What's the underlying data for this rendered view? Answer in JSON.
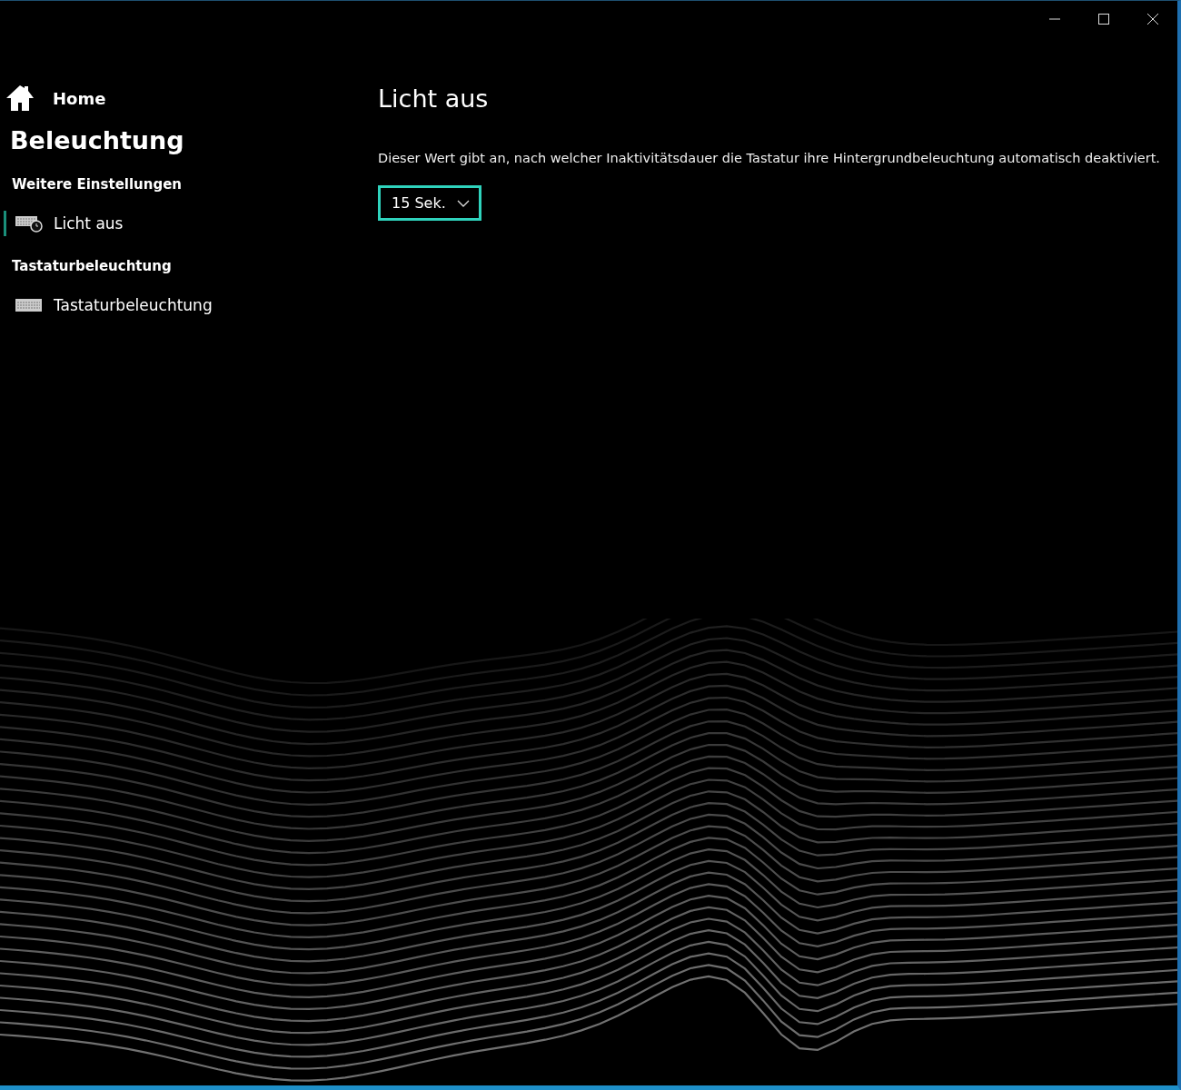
{
  "sidebar": {
    "home": "Home",
    "title": "Beleuchtung",
    "sections": [
      {
        "heading": "Weitere Einstellungen",
        "items": [
          {
            "label": "Licht aus",
            "kind": "timer",
            "selected": true
          }
        ]
      },
      {
        "heading": "Tastaturbeleuchtung",
        "items": [
          {
            "label": "Tastaturbeleuchtung",
            "kind": "keyboard",
            "selected": false
          }
        ]
      }
    ]
  },
  "content": {
    "title": "Licht aus",
    "description": "Dieser Wert gibt an, nach welcher Inaktivitätsdauer die Tastatur ihre Hintergrundbeleuchtung automatisch deaktiviert.",
    "dropdown": {
      "value": "15 Sek."
    }
  }
}
